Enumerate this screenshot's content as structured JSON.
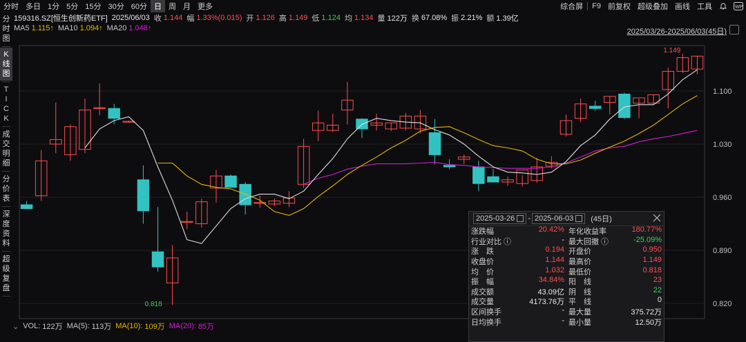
{
  "period_tabs": [
    {
      "label": "分时",
      "active": false
    },
    {
      "label": "多日",
      "active": false
    },
    {
      "label": "1分",
      "active": false
    },
    {
      "label": "5分",
      "active": false
    },
    {
      "label": "15分",
      "active": false
    },
    {
      "label": "30分",
      "active": false
    },
    {
      "label": "60分",
      "active": false
    },
    {
      "label": "日",
      "active": true
    },
    {
      "label": "周",
      "active": false
    },
    {
      "label": "月",
      "active": false
    },
    {
      "label": "更多",
      "active": false
    }
  ],
  "right_menu": {
    "layout": "综合屏",
    "f9": "F9",
    "adjust": "前复权",
    "overlay": "超级叠加",
    "draw": "画线",
    "tools": "工具"
  },
  "quote": {
    "code": "159316.SZ[恒生创新药ETF]",
    "date": "2025/06/03",
    "close_label": "收",
    "close": "1.144",
    "change_label": "幅",
    "change": "1.33%(0.015)",
    "open_label": "开",
    "open": "1.126",
    "high_label": "高",
    "high": "1.149",
    "low_label": "低",
    "low": "1.124",
    "avg_label": "均",
    "avg": "1.134",
    "vol_label": "量",
    "vol": "122万",
    "turnover_label": "换",
    "turnover": "67.08%",
    "amp_label": "振",
    "amp": "2.21%",
    "amount_label": "额",
    "amount": "1.39亿"
  },
  "sidebar": [
    {
      "label": "分时图",
      "active": false
    },
    {
      "label": "K线图",
      "active": true
    },
    {
      "label": "TICK",
      "active": false
    },
    {
      "label": "成交明细",
      "active": false
    },
    {
      "label": "分价表",
      "active": false
    },
    {
      "label": "深度资料",
      "active": false
    },
    {
      "label": "超级复盘",
      "active": false
    }
  ],
  "ma": {
    "ma5_label": "MA5",
    "ma5": "1.115↑",
    "ma10_label": "MA10",
    "ma10": "1.094↑",
    "ma20_label": "MA20",
    "ma20": "1.048↑"
  },
  "range_label": "2025/03/26-2025/06/03(45日)",
  "y_ticks": [
    "1.100",
    "1.030",
    "0.960",
    "0.890",
    "0.820"
  ],
  "annotations": {
    "high": "1.149",
    "low": "0.818"
  },
  "colors": {
    "up": "#ff4d4f",
    "down": "#33c2c2",
    "ma5": "#e0e0e0",
    "ma10": "#e6b800",
    "ma20": "#d020d0",
    "grid": "#3a3a3a"
  },
  "chart_data": {
    "type": "candlestick",
    "ylim": [
      0.8,
      1.16
    ],
    "candles": [
      {
        "o": 0.95,
        "h": 0.955,
        "l": 0.945,
        "c": 0.945
      },
      {
        "o": 0.962,
        "h": 1.022,
        "l": 0.955,
        "c": 1.008
      },
      {
        "o": 1.03,
        "h": 1.085,
        "l": 1.018,
        "c": 1.036
      },
      {
        "o": 1.016,
        "h": 1.056,
        "l": 1.008,
        "c": 1.053
      },
      {
        "o": 1.023,
        "h": 1.09,
        "l": 1.018,
        "c": 1.075
      },
      {
        "o": 1.078,
        "h": 1.11,
        "l": 1.068,
        "c": 1.078
      },
      {
        "o": 1.077,
        "h": 1.083,
        "l": 1.056,
        "c": 1.064
      },
      {
        "o": 1.059,
        "h": 1.061,
        "l": 1.058,
        "c": 1.06
      },
      {
        "o": 0.983,
        "h": 1.002,
        "l": 0.925,
        "c": 0.942
      },
      {
        "o": 0.888,
        "h": 0.947,
        "l": 0.862,
        "c": 0.868
      },
      {
        "o": 0.847,
        "h": 0.897,
        "l": 0.818,
        "c": 0.88
      },
      {
        "o": 0.928,
        "h": 0.941,
        "l": 0.918,
        "c": 0.928
      },
      {
        "o": 0.925,
        "h": 0.958,
        "l": 0.92,
        "c": 0.954
      },
      {
        "o": 0.972,
        "h": 0.996,
        "l": 0.953,
        "c": 0.988
      },
      {
        "o": 0.988,
        "h": 0.99,
        "l": 0.973,
        "c": 0.973
      },
      {
        "o": 0.977,
        "h": 0.98,
        "l": 0.937,
        "c": 0.95
      },
      {
        "o": 0.953,
        "h": 0.962,
        "l": 0.946,
        "c": 0.953
      },
      {
        "o": 0.951,
        "h": 0.958,
        "l": 0.948,
        "c": 0.955
      },
      {
        "o": 0.952,
        "h": 0.968,
        "l": 0.947,
        "c": 0.959
      },
      {
        "o": 0.977,
        "h": 1.037,
        "l": 0.972,
        "c": 1.027
      },
      {
        "o": 1.048,
        "h": 1.074,
        "l": 1.034,
        "c": 1.058
      },
      {
        "o": 1.048,
        "h": 1.07,
        "l": 1.046,
        "c": 1.055
      },
      {
        "o": 1.075,
        "h": 1.112,
        "l": 1.056,
        "c": 1.088
      },
      {
        "o": 1.063,
        "h": 1.064,
        "l": 1.038,
        "c": 1.05
      },
      {
        "o": 1.055,
        "h": 1.07,
        "l": 1.048,
        "c": 1.058
      },
      {
        "o": 1.05,
        "h": 1.058,
        "l": 1.047,
        "c": 1.058
      },
      {
        "o": 1.051,
        "h": 1.071,
        "l": 1.048,
        "c": 1.067
      },
      {
        "o": 1.05,
        "h": 1.075,
        "l": 1.044,
        "c": 1.067
      },
      {
        "o": 1.045,
        "h": 1.063,
        "l": 1.003,
        "c": 1.016
      },
      {
        "o": 1.002,
        "h": 1.01,
        "l": 0.997,
        "c": 1.0
      },
      {
        "o": 1.01,
        "h": 1.016,
        "l": 1.004,
        "c": 1.013
      },
      {
        "o": 1.0,
        "h": 1.008,
        "l": 0.968,
        "c": 0.978
      },
      {
        "o": 0.987,
        "h": 0.997,
        "l": 0.982,
        "c": 0.98
      },
      {
        "o": 0.98,
        "h": 0.987,
        "l": 0.975,
        "c": 0.983
      },
      {
        "o": 0.978,
        "h": 0.989,
        "l": 0.974,
        "c": 0.996
      },
      {
        "o": 0.982,
        "h": 1.012,
        "l": 0.979,
        "c": 1.0
      },
      {
        "o": 1.001,
        "h": 1.014,
        "l": 0.998,
        "c": 1.006
      },
      {
        "o": 1.043,
        "h": 1.069,
        "l": 1.04,
        "c": 1.061
      },
      {
        "o": 1.064,
        "h": 1.09,
        "l": 1.059,
        "c": 1.083
      },
      {
        "o": 1.08,
        "h": 1.087,
        "l": 1.074,
        "c": 1.077
      },
      {
        "o": 1.085,
        "h": 1.093,
        "l": 1.069,
        "c": 1.093
      },
      {
        "o": 1.096,
        "h": 1.098,
        "l": 1.063,
        "c": 1.065
      },
      {
        "o": 1.084,
        "h": 1.09,
        "l": 1.064,
        "c": 1.091
      },
      {
        "o": 1.084,
        "h": 1.095,
        "l": 1.083,
        "c": 1.095
      },
      {
        "o": 1.102,
        "h": 1.131,
        "l": 1.077,
        "c": 1.126
      },
      {
        "o": 1.126,
        "h": 1.149,
        "l": 1.124,
        "c": 1.144
      },
      {
        "o": 1.129,
        "h": 1.146,
        "l": 1.122,
        "c": 1.146
      }
    ],
    "ma5": [
      null,
      null,
      null,
      null,
      1.025,
      1.05,
      1.061,
      1.066,
      1.048,
      1.0,
      0.956,
      0.904,
      0.899,
      0.922,
      0.945,
      0.958,
      0.964,
      0.964,
      0.958,
      0.968,
      0.99,
      1.011,
      1.037,
      1.056,
      1.064,
      1.061,
      1.059,
      1.058,
      1.049,
      1.042,
      1.03,
      1.014,
      1.0,
      0.993,
      0.992,
      0.99,
      0.993,
      1.007,
      1.028,
      1.042,
      1.063,
      1.079,
      1.082,
      1.082,
      1.096,
      1.115,
      1.128
    ],
    "ma10": [
      null,
      null,
      null,
      null,
      null,
      null,
      null,
      null,
      null,
      1.005,
      1.005,
      0.988,
      0.977,
      0.973,
      0.971,
      0.964,
      0.956,
      0.941,
      0.936,
      0.945,
      0.961,
      0.975,
      0.99,
      1.002,
      1.013,
      1.025,
      1.035,
      1.047,
      1.052,
      1.053,
      1.045,
      1.036,
      1.028,
      1.025,
      1.021,
      1.01,
      1.004,
      1.004,
      1.009,
      1.018,
      1.026,
      1.034,
      1.044,
      1.055,
      1.069,
      1.083,
      1.094
    ],
    "ma20": [
      null,
      null,
      null,
      null,
      null,
      null,
      null,
      null,
      null,
      null,
      null,
      null,
      null,
      null,
      null,
      null,
      null,
      null,
      null,
      0.977,
      0.985,
      0.99,
      0.997,
      1.001,
      1.004,
      1.004,
      1.004,
      1.005,
      1.006,
      1.003,
      1.002,
      1.0,
      0.999,
      0.998,
      0.998,
      0.998,
      1.0,
      1.005,
      1.013,
      1.021,
      1.025,
      1.027,
      1.033,
      1.037,
      1.04,
      1.044,
      1.048
    ]
  },
  "stats": {
    "date_from": "2025-03-26",
    "date_to": "2025-06-03",
    "sep": "-",
    "days": "(45日)",
    "rows": [
      [
        {
          "k": "涨跌幅",
          "v": "20.42%",
          "c": "r"
        },
        {
          "k": "年化收益率",
          "v": "180.77%",
          "c": "r"
        }
      ],
      [
        {
          "k": "行业对比 ⓘ",
          "v": "-",
          "c": "w"
        },
        {
          "k": "最大回撤 ⓘ",
          "v": "-25.09%",
          "c": "g"
        }
      ],
      [
        {
          "k": "涨　跌",
          "v": "0.194",
          "c": "r"
        },
        {
          "k": "开盘价",
          "v": "0.950",
          "c": "r"
        }
      ],
      [
        {
          "k": "收盘价",
          "v": "1.144",
          "c": "r"
        },
        {
          "k": "最高价",
          "v": "1.149",
          "c": "r"
        }
      ],
      [
        {
          "k": "均　价",
          "v": "1.032",
          "c": "r"
        },
        {
          "k": "最低价",
          "v": "0.818",
          "c": "r"
        }
      ],
      [
        {
          "k": "振　幅",
          "v": "34.84%",
          "c": "r"
        },
        {
          "k": "阳　线",
          "v": "23",
          "c": "r"
        }
      ],
      [
        {
          "k": "成交额",
          "v": "43.09亿",
          "c": "w"
        },
        {
          "k": "阴　线",
          "v": "22",
          "c": "g"
        }
      ],
      [
        {
          "k": "成交量",
          "v": "4173.76万",
          "c": "w"
        },
        {
          "k": "平　线",
          "v": "0",
          "c": "w"
        }
      ],
      [
        {
          "k": "区间换手",
          "v": "-",
          "c": "w"
        },
        {
          "k": "最大量",
          "v": "375.72万",
          "c": "w"
        }
      ],
      [
        {
          "k": "日均换手",
          "v": "-",
          "c": "w"
        },
        {
          "k": "最小量",
          "v": "12.50万",
          "c": "w"
        }
      ]
    ]
  },
  "volume": {
    "vol_label": "VOL:",
    "vol": "122万",
    "ma5_label": "MA(5):",
    "ma5": "113万",
    "ma10_label": "MA(10):",
    "ma10": "109万",
    "ma20_label": "MA(20):",
    "ma20": "85万"
  }
}
